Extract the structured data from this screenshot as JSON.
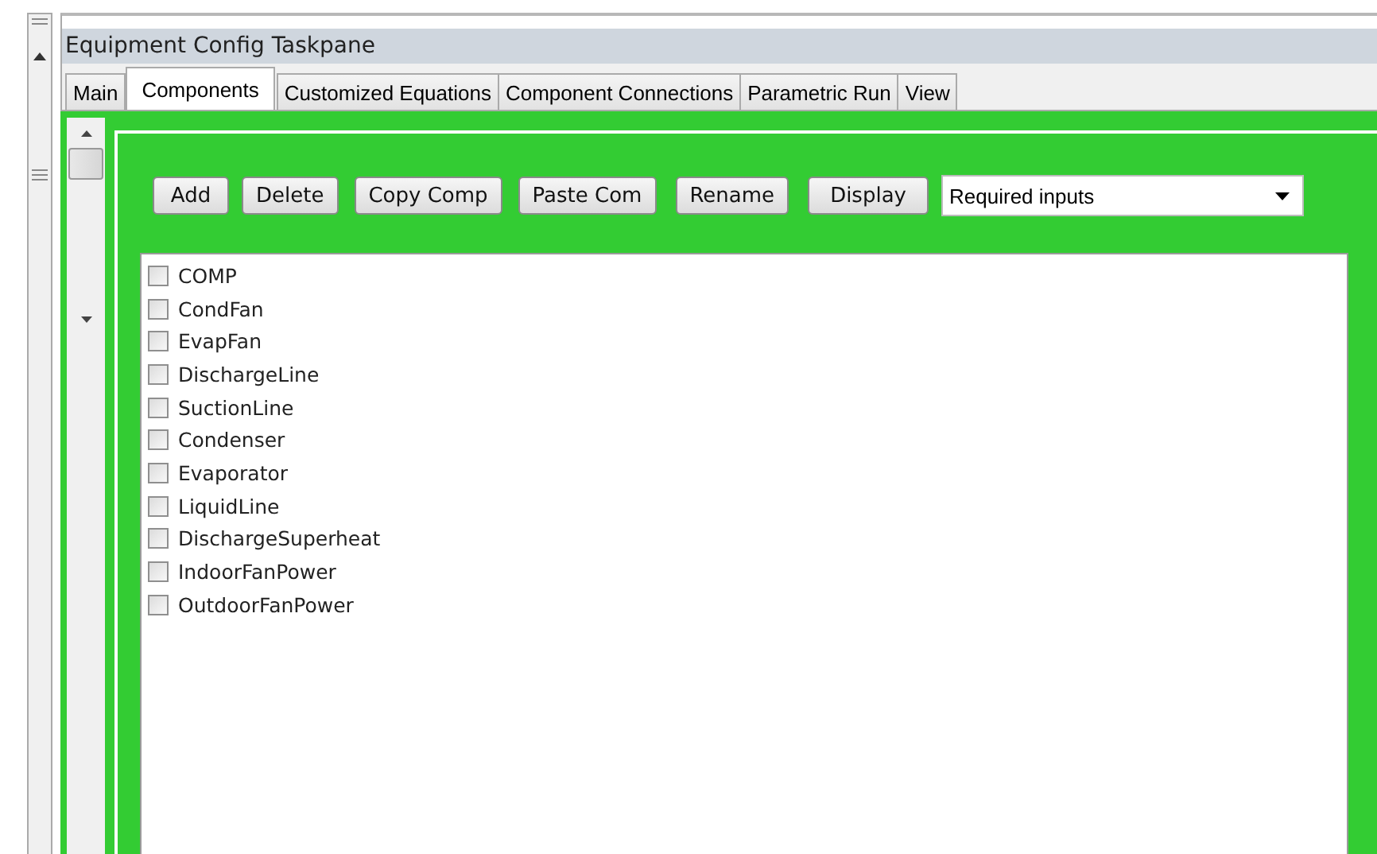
{
  "window": {
    "title": "Equipment Config Taskpane"
  },
  "tabs": [
    {
      "label": "Main",
      "selected": false
    },
    {
      "label": "Components",
      "selected": true
    },
    {
      "label": "Customized Equations",
      "selected": false
    },
    {
      "label": "Component Connections",
      "selected": false
    },
    {
      "label": "Parametric Run",
      "selected": false
    },
    {
      "label": "View",
      "selected": false
    }
  ],
  "toolbar": {
    "buttons": [
      "Add",
      "Delete",
      "Copy Comp",
      "Paste Com",
      "Rename",
      "Display"
    ],
    "dropdown": {
      "value": "Required inputs"
    }
  },
  "components": [
    {
      "label": "COMP",
      "checked": false
    },
    {
      "label": "CondFan",
      "checked": false
    },
    {
      "label": "EvapFan",
      "checked": false
    },
    {
      "label": "DischargeLine",
      "checked": false
    },
    {
      "label": "SuctionLine",
      "checked": false
    },
    {
      "label": "Condenser",
      "checked": false
    },
    {
      "label": "Evaporator",
      "checked": false
    },
    {
      "label": "LiquidLine",
      "checked": false
    },
    {
      "label": "DischargeSuperheat",
      "checked": false
    },
    {
      "label": "IndoorFanPower",
      "checked": false
    },
    {
      "label": "OutdoorFanPower",
      "checked": false
    }
  ]
}
